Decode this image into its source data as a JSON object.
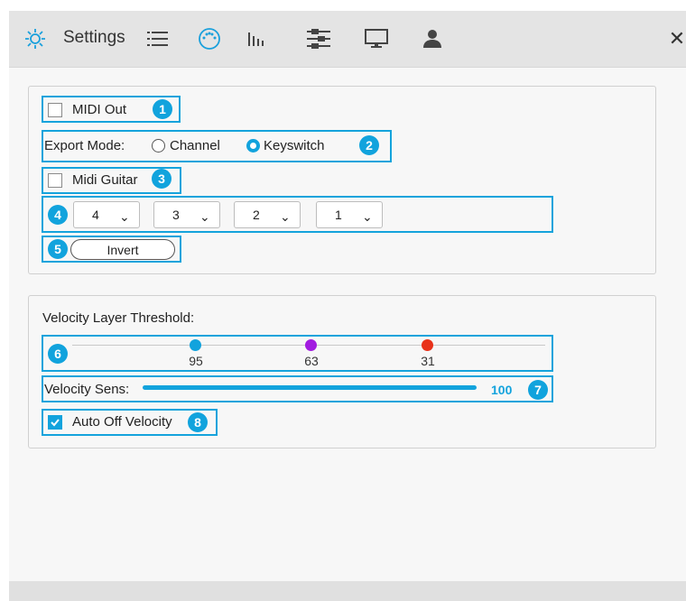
{
  "toolbar": {
    "title": "Settings",
    "close": "✕",
    "icons": [
      "settings-gear-icon",
      "list-icon",
      "midi-port-icon",
      "velocity-bars-icon",
      "mixer-sliders-icon",
      "monitor-icon",
      "user-icon"
    ]
  },
  "midi": {
    "midi_out_label": "MIDI Out",
    "midi_out_checked": false,
    "export_mode_label": "Export Mode:",
    "export_options": [
      "Channel",
      "Keyswitch"
    ],
    "export_selected": "Keyswitch",
    "midi_guitar_label": "Midi Guitar",
    "midi_guitar_checked": false,
    "string_selects": [
      "4",
      "3",
      "2",
      "1"
    ],
    "invert_label": "Invert"
  },
  "velocity": {
    "threshold_label": "Velocity Layer Threshold:",
    "thresholds": [
      {
        "value": "95",
        "color": "#12a3dd"
      },
      {
        "value": "63",
        "color": "#a21ce0"
      },
      {
        "value": "31",
        "color": "#e8321a"
      }
    ],
    "sens_label": "Velocity Sens:",
    "sens_value": "100",
    "auto_off_label": "Auto Off Velocity",
    "auto_off_checked": true
  },
  "badges": [
    "1",
    "2",
    "3",
    "4",
    "5",
    "6",
    "7",
    "8"
  ],
  "colors": {
    "accent": "#12a3dd",
    "highlight": "#14a3dc"
  }
}
